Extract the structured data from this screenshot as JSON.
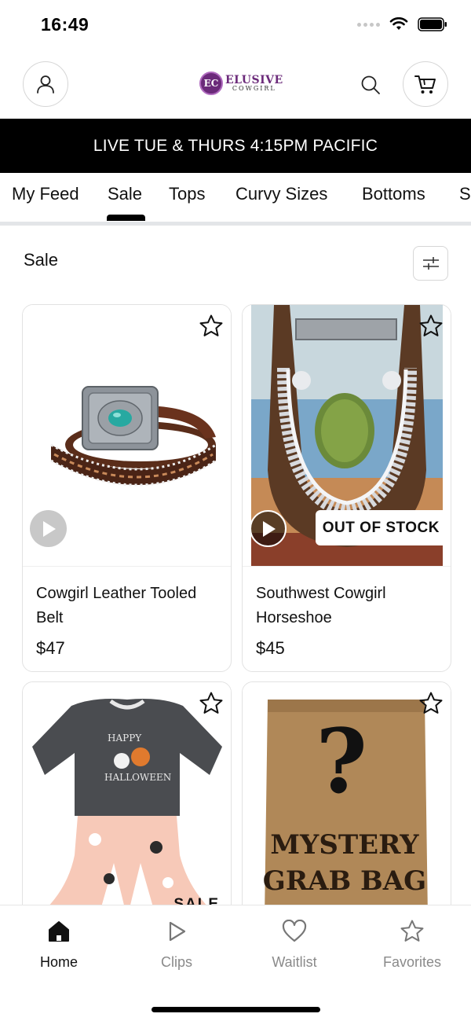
{
  "status_bar": {
    "time": "16:49"
  },
  "header": {
    "logo_initials": "EC",
    "logo_main": "ELUSIVE",
    "logo_sub": "COWGIRL"
  },
  "banner": {
    "text": "LIVE TUE & THURS 4:15PM PACIFIC"
  },
  "category_tabs": [
    {
      "label": "My Feed",
      "active": false
    },
    {
      "label": "Sale",
      "active": true
    },
    {
      "label": "Tops",
      "active": false
    },
    {
      "label": "Curvy Sizes",
      "active": false
    },
    {
      "label": "Bottoms",
      "active": false
    },
    {
      "label": "S",
      "active": false
    }
  ],
  "section": {
    "title": "Sale"
  },
  "products": [
    {
      "name": "Cowgirl Leather Tooled Belt",
      "price": "$47",
      "badge": ""
    },
    {
      "name": "Southwest Cowgirl Horseshoe",
      "price": "$45",
      "badge": "OUT OF STOCK"
    },
    {
      "name": "",
      "price": "",
      "badge": "SALE"
    },
    {
      "name": "",
      "price": "",
      "badge": ""
    }
  ],
  "product_image_text": {
    "mystery_line1": "MYSTERY",
    "mystery_line2": "GRAB BAG",
    "mystery_symbol": "?",
    "shirt_line1": "HAPPY",
    "shirt_line2": "HALLOWEEN"
  },
  "bottom_nav": [
    {
      "label": "Home",
      "icon": "home-icon",
      "active": true
    },
    {
      "label": "Clips",
      "icon": "play-outline-icon",
      "active": false
    },
    {
      "label": "Waitlist",
      "icon": "heart-icon",
      "active": false
    },
    {
      "label": "Favorites",
      "icon": "star-icon",
      "active": false
    }
  ],
  "colors": {
    "brand_purple": "#6b2a7a",
    "banner_bg": "#000000",
    "active_text": "#111111",
    "inactive_text": "#8a8a8a"
  }
}
